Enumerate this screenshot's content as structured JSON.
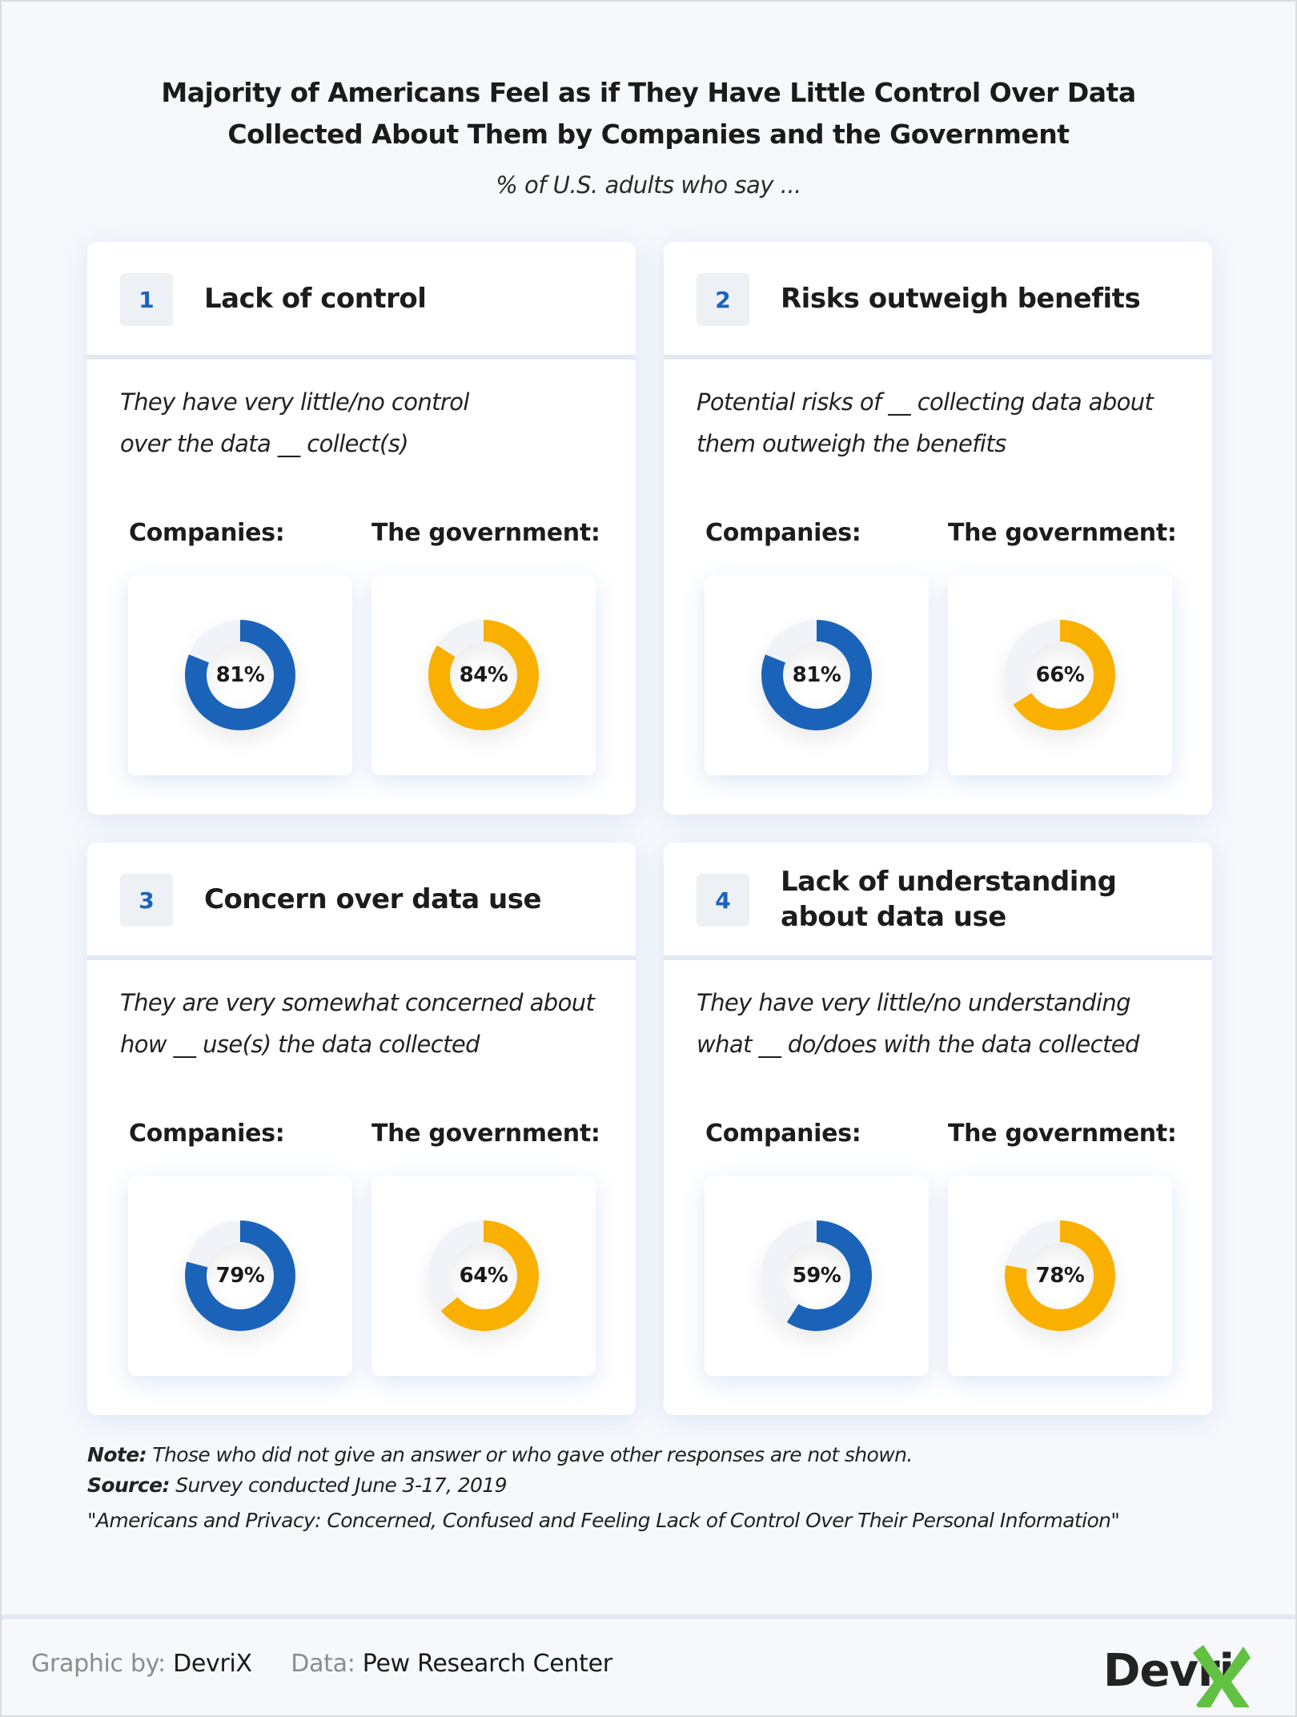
{
  "header": {
    "title_line1": "Majority of Americans Feel as if They Have Little Control Over Data",
    "title_line2": "Collected About Them by Companies and the Government",
    "subtitle": "% of U.S. adults who say ..."
  },
  "colors": {
    "companies": "#1b63b8",
    "government": "#f9b000",
    "track": "#f1f3f8",
    "badge_text": "#1b63b8"
  },
  "cards": [
    {
      "number": "1",
      "title": "Lack of control",
      "description": "They have very little/no control over the data __ collect(s)",
      "description_lines": [
        "They have very little/no control",
        "over the data __ collect(s)"
      ],
      "labels": [
        "Companies:",
        "The government:"
      ],
      "value_labels": [
        "81%",
        "84%"
      ]
    },
    {
      "number": "2",
      "title": "Risks outweigh benefits",
      "description_lines": [
        "Potential risks of __ collecting data about",
        "them outweigh the benefits"
      ],
      "labels": [
        "Companies:",
        "The government:"
      ],
      "value_labels": [
        "81%",
        "66%"
      ]
    },
    {
      "number": "3",
      "title": "Concern over data use",
      "description_lines": [
        "They are very somewhat concerned about",
        "how __ use(s) the data collected"
      ],
      "labels": [
        "Companies:",
        "The government:"
      ],
      "value_labels": [
        "79%",
        "64%"
      ]
    },
    {
      "number": "4",
      "title": "Lack of understanding about data use",
      "title_lines": [
        "Lack of understanding",
        "about data use"
      ],
      "description_lines": [
        "They have very little/no understanding",
        "what __ do/does with the data collected"
      ],
      "labels": [
        "Companies:",
        "The government:"
      ],
      "value_labels": [
        "59%",
        "78%"
      ]
    }
  ],
  "notes": {
    "note_label": "Note:",
    "note_text": " Those who did not give an answer or who gave other responses are not shown.",
    "source_label": "Source:",
    "source_text": " Survey conducted June 3-17, 2019",
    "quote": "\"Americans and Privacy: Concerned, Confused and Feeling Lack of Control Over Their Personal Information\""
  },
  "footer": {
    "graphic_by_label": "Graphic by:",
    "graphic_by_value": "DevriX",
    "data_label": "Data:",
    "data_value": "Pew Research Center",
    "logo_text": "Devri",
    "logo_icon": "x-mark-icon"
  },
  "chart_data": {
    "type": "pie",
    "subtype": "donut",
    "title": "Majority of Americans Feel as if They Have Little Control Over Data Collected About Them by Companies and the Government",
    "subtitle": "% of U.S. adults who say ...",
    "categories": [
      "Lack of control",
      "Risks outweigh benefits",
      "Concern over data use",
      "Lack of understanding about data use"
    ],
    "series": [
      {
        "name": "Companies",
        "values": [
          81,
          81,
          79,
          59
        ]
      },
      {
        "name": "The government",
        "values": [
          84,
          66,
          64,
          78
        ]
      }
    ],
    "unit": "%",
    "max": 100
  }
}
